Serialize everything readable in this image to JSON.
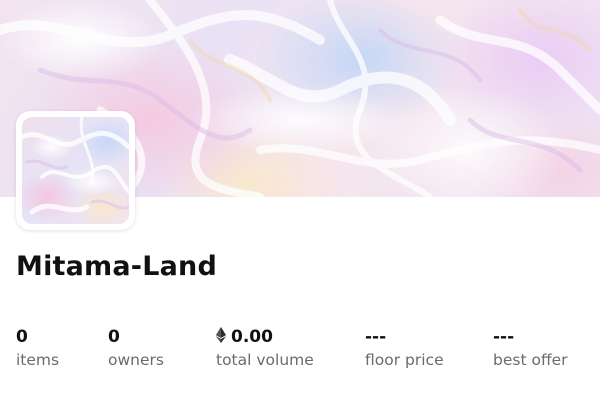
{
  "banner": {
    "image": "iridescent-holographic-foil"
  },
  "avatar": {
    "image": "iridescent-holographic-foil"
  },
  "collection": {
    "name": "Mitama-Land"
  },
  "stats": {
    "items": {
      "value": "0",
      "label": "items"
    },
    "owners": {
      "value": "0",
      "label": "owners"
    },
    "total_volume": {
      "value": "0.00",
      "label": "total volume",
      "icon": "ethereum-icon"
    },
    "floor_price": {
      "value": "---",
      "label": "floor price"
    },
    "best_offer": {
      "value": "---",
      "label": "best offer"
    }
  },
  "colors": {
    "text_primary": "#111111",
    "text_secondary": "#6b6b6b",
    "background": "#ffffff"
  }
}
